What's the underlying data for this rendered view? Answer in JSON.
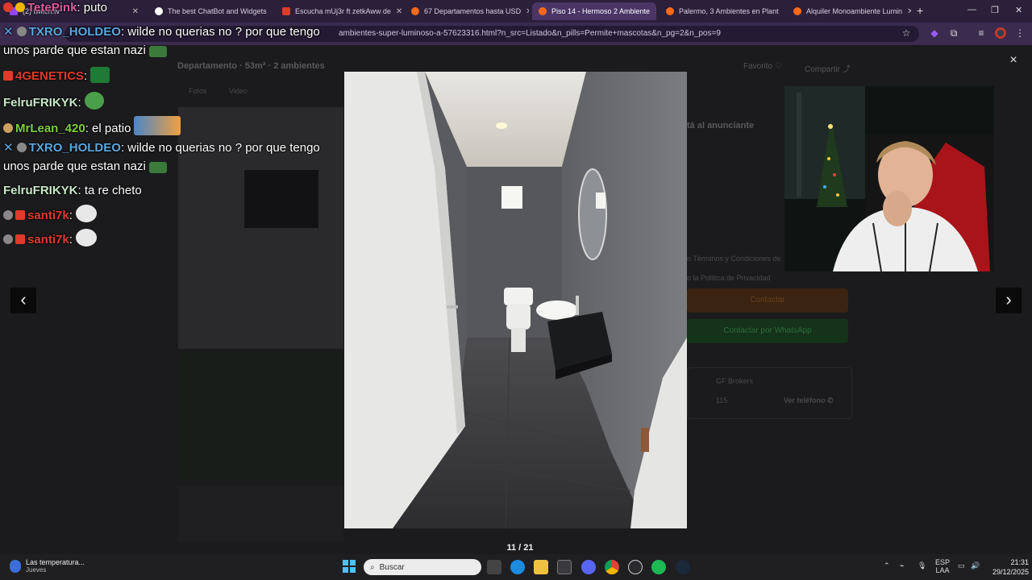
{
  "browser": {
    "tabs": [
      {
        "label": "(2) twitch.tv",
        "active": false
      },
      {
        "label": "The best ChatBot and Widgets",
        "active": false
      },
      {
        "label": "Escucha mUj3r ft zetkAww de",
        "active": false
      },
      {
        "label": "67 Departamentos hasta USD",
        "active": false
      },
      {
        "label": "Piso 14 - Hermoso 2 Ambiente",
        "active": true
      },
      {
        "label": "Palermo, 3 Ambientes en Plant",
        "active": false
      },
      {
        "label": "Alquiler Monoambiente Lumin",
        "active": false
      }
    ],
    "new_tab_label": "+",
    "url": "ambientes-super-luminoso-a-57623316.html?n_src=Listado&n_pills=Permite+mascotas&n_pg=2&n_pos=9"
  },
  "listing": {
    "title": "Departamento · 53m² · 2 ambientes",
    "tab_photos": "Fotos",
    "tab_video": "Video",
    "favorite": "Favorito",
    "share": "Compartir",
    "contact_heading": "tá al anunciante",
    "contact_button": "Contactar",
    "whatsapp_button": "Contactar por WhatsApp",
    "agency": "GF Brokers",
    "agency_code": "115",
    "phone_link": "Ver teléfono",
    "terms_line": "n Términos y Condiciones de",
    "privacy_line": "o la Política de Privacidad"
  },
  "lightbox": {
    "counter": "11 / 21",
    "close_label": "×",
    "prev_label": "‹",
    "next_label": "›"
  },
  "chat": {
    "messages": [
      {
        "user": "TetePink",
        "text": ": puto",
        "color": "#e05aa0"
      },
      {
        "user": "TXRO_HOLDEO",
        "text": ": wilde no querias no ? por que tengo",
        "color": "#5aa8e0"
      },
      {
        "user": "",
        "text": "unos parde que estan nazi",
        "color": "#ffffff"
      },
      {
        "user": "4GENETICS",
        "text": ":",
        "color": "#e03a2a"
      },
      {
        "user": "FelruFRIKYK",
        "text": ":",
        "color": "#c8e8c8"
      },
      {
        "user": "MrLean_420",
        "text": ": el patio",
        "color": "#7ad03a"
      },
      {
        "user": "TXRO_HOLDEO",
        "text": ": wilde no querias no ? por que tengo",
        "color": "#5aa8e0"
      },
      {
        "user": "",
        "text": "unos parde que estan nazi",
        "color": "#ffffff"
      },
      {
        "user": "FelruFRIKYK",
        "text": ": ta re cheto",
        "color": "#c8e8c8"
      },
      {
        "user": "santi7k",
        "text": ":",
        "color": "#e03a2a"
      },
      {
        "user": "santi7k",
        "text": ":",
        "color": "#e03a2a"
      }
    ]
  },
  "taskbar": {
    "weather_title": "Las temperatura...",
    "weather_sub": "Jueves",
    "search_placeholder": "Buscar",
    "lang_top": "ESP",
    "lang_bottom": "LAA",
    "time": "21:31",
    "date": "29/12/2025"
  }
}
